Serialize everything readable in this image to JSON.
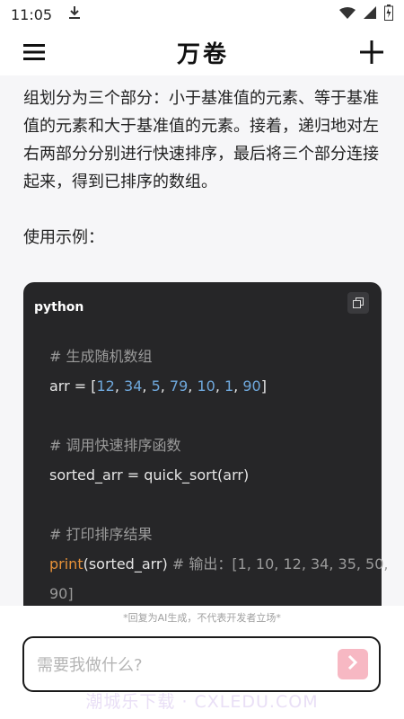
{
  "status_bar": {
    "time": "11:05"
  },
  "header": {
    "title": "万卷"
  },
  "content": {
    "paragraph": "组划分为三个部分：小于基准值的元素、等于基准值的元素和大于基准值的元素。接着，递归地对左右两部分分别进行快速排序，最后将三个部分连接起来，得到已排序的数组。",
    "example_label": "使用示例："
  },
  "code_block": {
    "language": "python",
    "comment_1": "# 生成随机数组",
    "arr_prefix": "arr = [",
    "arr_numbers": [
      "12",
      "34",
      "5",
      "79",
      "10",
      "1",
      "90"
    ],
    "arr_suffix": "]",
    "comment_2": "# 调用快速排序函数",
    "sorted_line": "sorted_arr = quick_sort(arr)",
    "comment_3": "# 打印排序结果",
    "print_func": "print",
    "print_args": "(sorted_arr)",
    "print_comment": "# 输出：",
    "print_output": "[1, 10, 12, 34, 35, 50,",
    "print_output_cont": "90]"
  },
  "footer": {
    "disclaimer": "*回复为AI生成，不代表开发者立场*",
    "input_placeholder": "需要我做什么?",
    "watermark": "潮城乐下载 · CXLEDU.COM"
  },
  "colors": {
    "code_bg": "#262628",
    "comment": "#9a9a9a",
    "number": "#6fa8dc",
    "function": "#e69138",
    "send_button": "#f7b8c3"
  }
}
